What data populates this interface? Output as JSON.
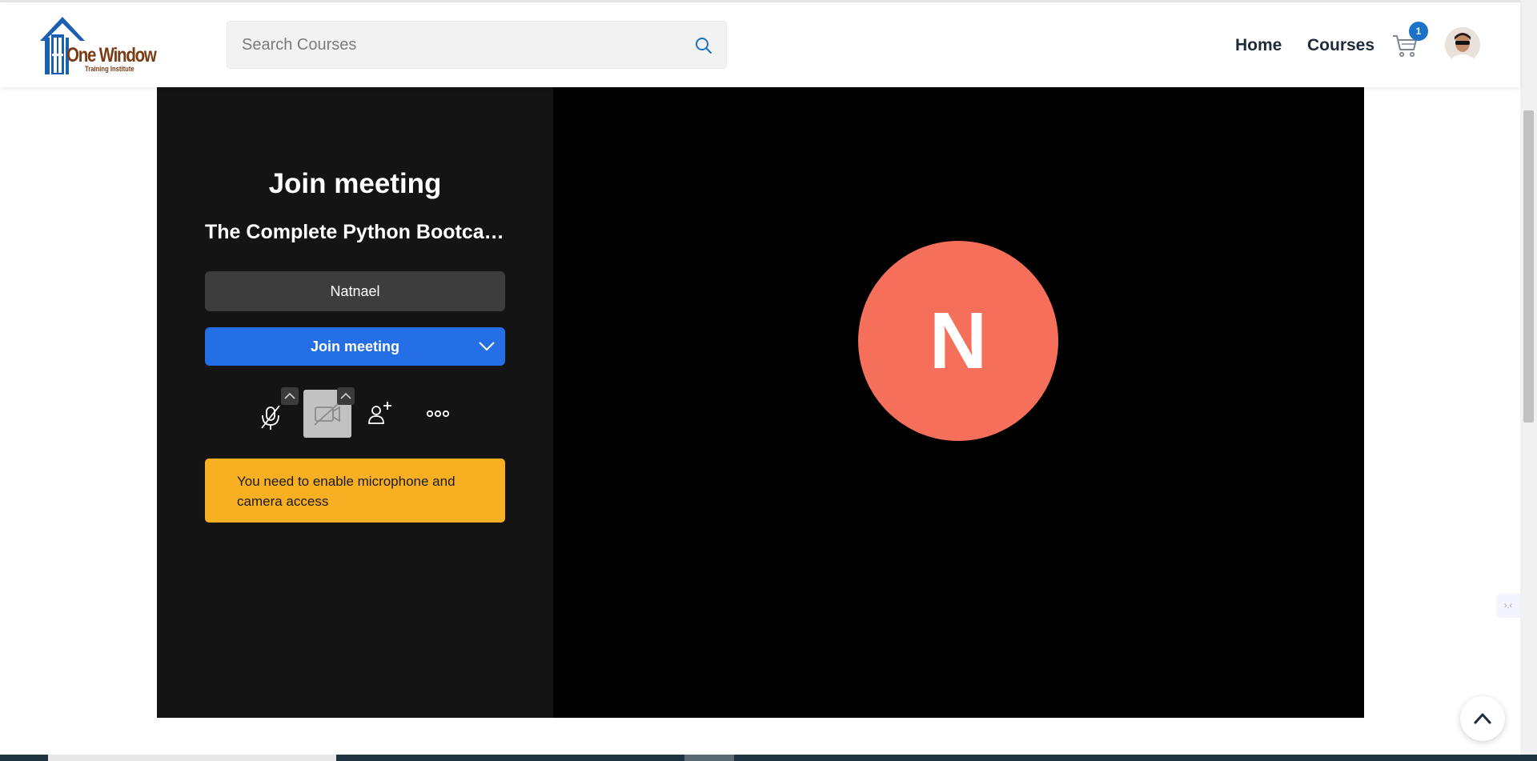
{
  "header": {
    "logo": {
      "name": "One Window",
      "subtitle": "Training Institute"
    },
    "search": {
      "placeholder": "Search Courses",
      "value": ""
    },
    "nav": {
      "home": "Home",
      "courses": "Courses"
    },
    "cart": {
      "count": "1"
    },
    "colors": {
      "brand_blue": "#1a73c8",
      "brand_brown": "#7a3c14",
      "nav_text": "#1f2b3a"
    }
  },
  "meeting": {
    "title": "Join meeting",
    "subject": "The Complete Python Bootcamp",
    "name_value": "Natnael",
    "join_button": "Join meeting",
    "toolbar": {
      "mic_icon": "microphone-off-icon",
      "camera_icon": "camera-off-icon",
      "invite_icon": "add-person-icon",
      "more_icon": "more-options-icon"
    },
    "warning": "You need to enable microphone and camera access",
    "avatar_initial": "N",
    "colors": {
      "join": "#246fe5",
      "warning": "#f8af21",
      "avatar": "#f56f5a"
    }
  },
  "side_widget": {
    "text": "›.‹"
  }
}
